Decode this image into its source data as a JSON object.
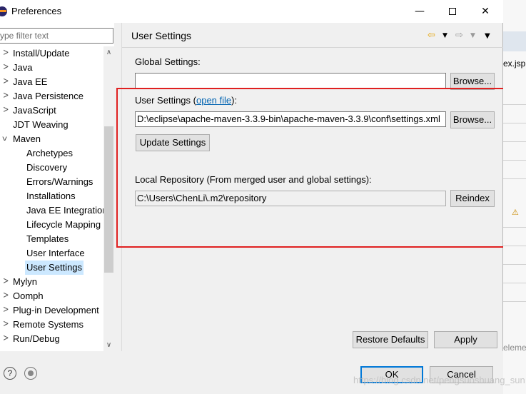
{
  "window": {
    "title": "Preferences",
    "min_glyph": "—",
    "close_glyph": "✕"
  },
  "filter": {
    "placeholder": "ype filter text"
  },
  "tree": {
    "items": [
      {
        "label": "Install/Update",
        "chev": ">"
      },
      {
        "label": "Java",
        "chev": ">"
      },
      {
        "label": "Java EE",
        "chev": ">"
      },
      {
        "label": "Java Persistence",
        "chev": ">"
      },
      {
        "label": "JavaScript",
        "chev": ">"
      },
      {
        "label": "JDT Weaving",
        "chev": ""
      },
      {
        "label": "Maven",
        "chev": "v"
      },
      {
        "label": "Archetypes",
        "chev": ""
      },
      {
        "label": "Discovery",
        "chev": ""
      },
      {
        "label": "Errors/Warnings",
        "chev": ""
      },
      {
        "label": "Installations",
        "chev": ""
      },
      {
        "label": "Java EE Integration",
        "chev": ""
      },
      {
        "label": "Lifecycle Mapping",
        "chev": ""
      },
      {
        "label": "Templates",
        "chev": ""
      },
      {
        "label": "User Interface",
        "chev": ""
      },
      {
        "label": "User Settings",
        "chev": ""
      },
      {
        "label": "Mylyn",
        "chev": ">"
      },
      {
        "label": "Oomph",
        "chev": ">"
      },
      {
        "label": "Plug-in Development",
        "chev": ">"
      },
      {
        "label": "Remote Systems",
        "chev": ">"
      },
      {
        "label": "Run/Debug",
        "chev": ">"
      }
    ],
    "selected": "User Settings"
  },
  "page": {
    "title": "User Settings",
    "global_label": "Global Settings:",
    "global_value": "",
    "browse_label": "Browse...",
    "user_label_prefix": "User Settings (",
    "user_link": "open file",
    "user_label_suffix": "):",
    "user_value": "D:\\eclipse\\apache-maven-3.3.9-bin\\apache-maven-3.3.9\\conf\\settings.xml",
    "update_label": "Update Settings",
    "local_label": "Local Repository (From merged user and global settings):",
    "local_value": "C:\\Users\\ChenLi\\.m2\\repository",
    "reindex_label": "Reindex"
  },
  "footer": {
    "restore_label": "Restore Defaults",
    "apply_label": "Apply",
    "ok_label": "OK",
    "cancel_label": "Cancel",
    "help_glyph": "?",
    "watermark": "https://blog.csdn.net/pengsuoshuang_sun"
  },
  "background": {
    "tab_label": "ex.jsp",
    "elem_label": "eleme"
  },
  "colors": {
    "highlight_box": "#e02020",
    "selection": "#cce8ff",
    "link": "#0063b1",
    "default_button_border": "#0078d7"
  }
}
